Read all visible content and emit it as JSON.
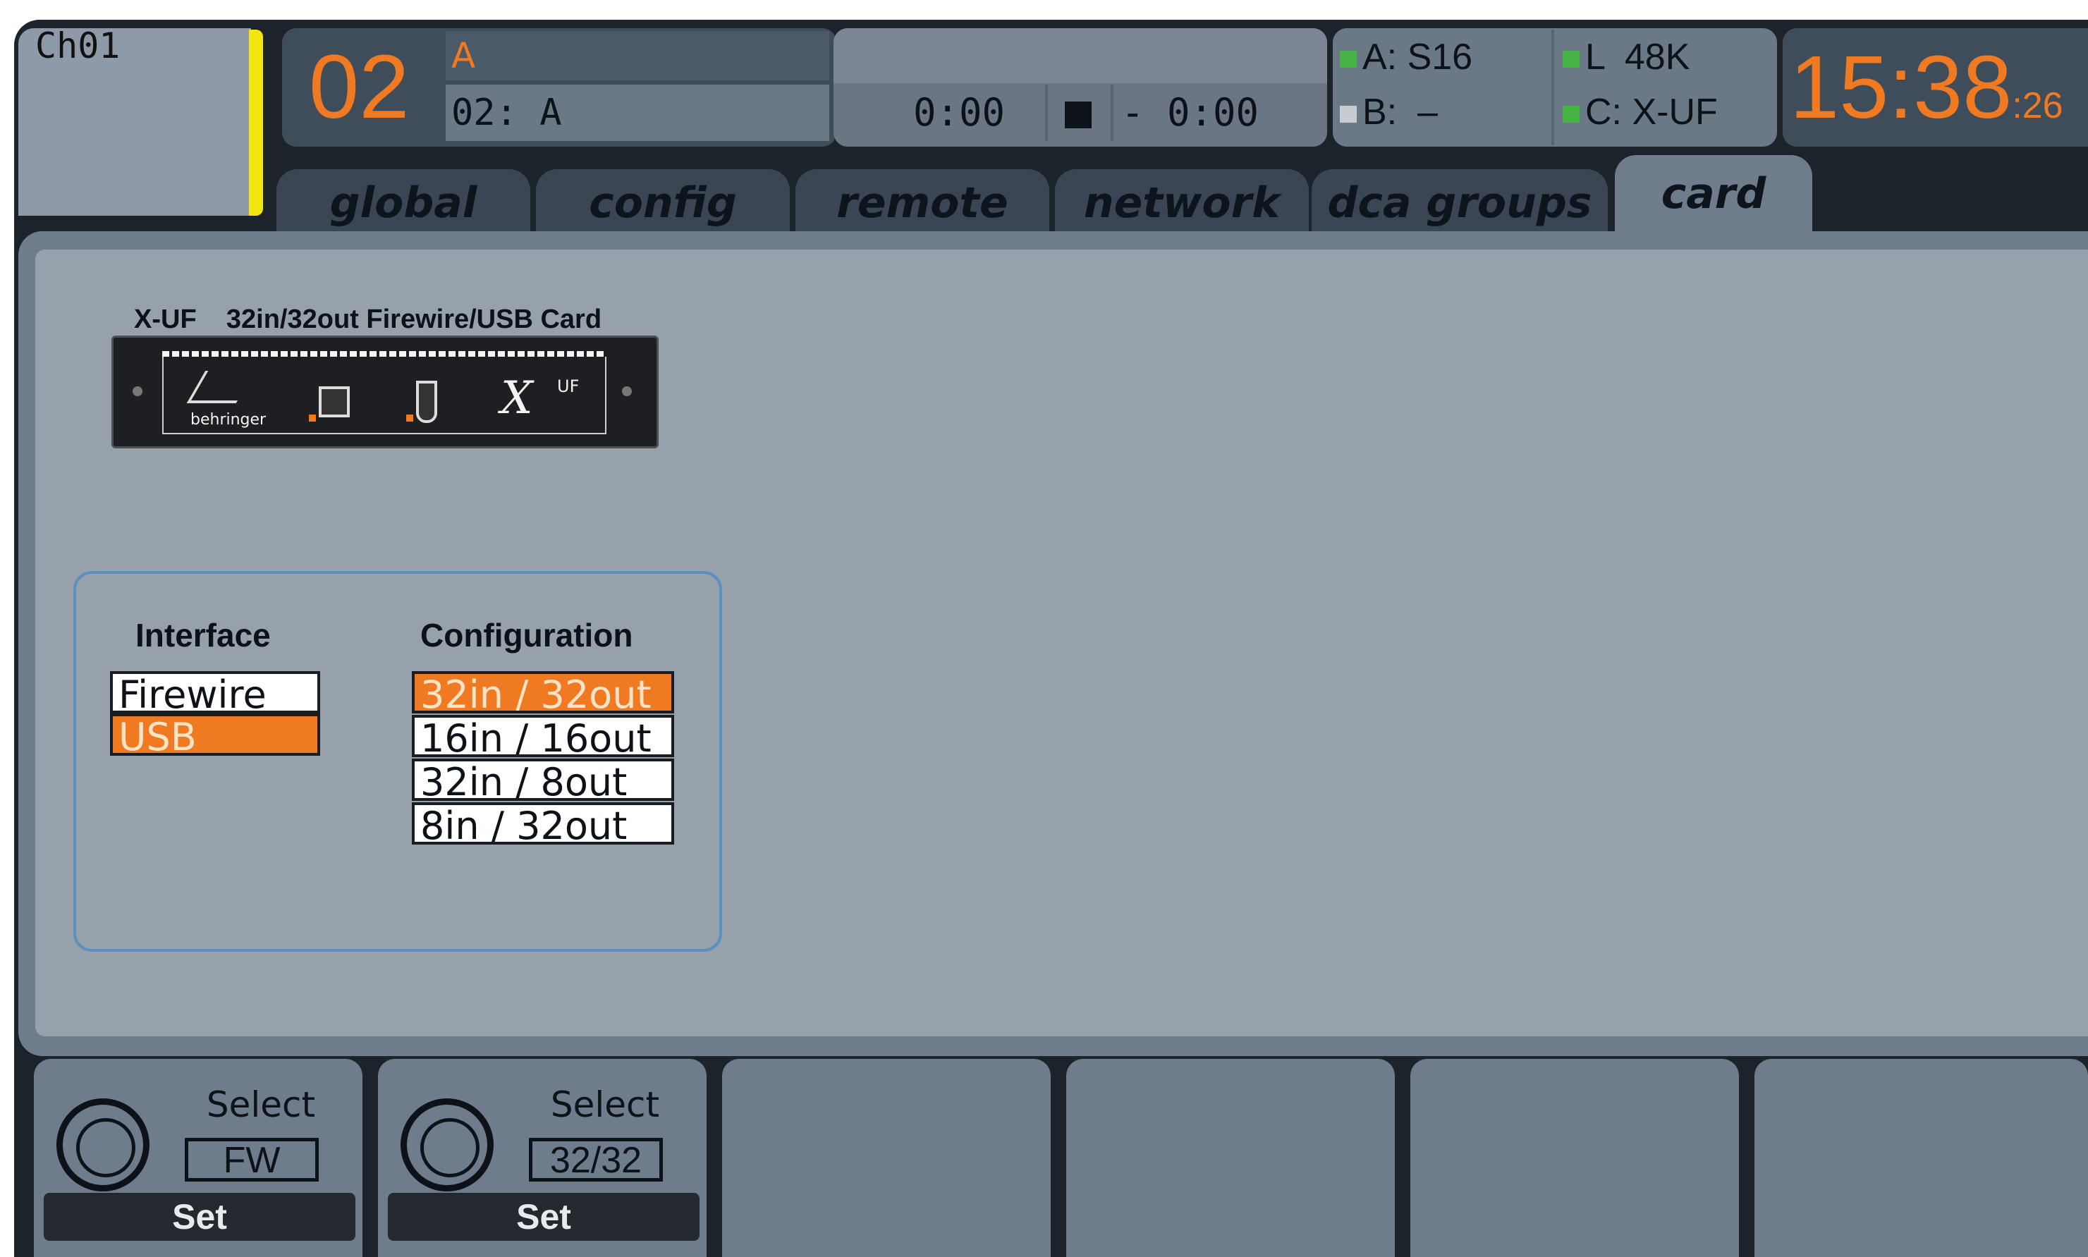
{
  "header": {
    "channel_label": "Ch01",
    "scene_number": "02",
    "scene_name": "A",
    "scene_sub": "02: A",
    "player_time": "0:00",
    "player_remaining": "- 0:00",
    "status": {
      "a_label": "A: S16",
      "b_label": "B:  –",
      "l_label": "L  48K",
      "c_label": "C: X-UF"
    },
    "clock_main": "15:38",
    "clock_sec": ":26"
  },
  "tabs": [
    {
      "label": "global"
    },
    {
      "label": "config"
    },
    {
      "label": "remote"
    },
    {
      "label": "network"
    },
    {
      "label": "dca groups"
    },
    {
      "label": "card"
    }
  ],
  "card": {
    "title": "X-UF    32in/32out Firewire/USB Card",
    "brand_text": "behringer",
    "logo_text": "X",
    "logo_sup": "UF"
  },
  "interface": {
    "heading": "Interface",
    "options": [
      "Firewire",
      "USB"
    ],
    "selected_index": 1
  },
  "configuration": {
    "heading": "Configuration",
    "options": [
      "32in / 32out",
      "16in / 16out",
      "32in / 8out",
      "8in / 32out"
    ],
    "selected_index": 0
  },
  "encoders": [
    {
      "label": "Select",
      "value": "FW",
      "button": "Set"
    },
    {
      "label": "Select",
      "value": "32/32",
      "button": "Set"
    }
  ],
  "colors": {
    "accent_orange": "#f07a22",
    "status_green": "#46b446",
    "status_gray": "#c8ccd0",
    "indicator_yellow": "#f1e512"
  }
}
